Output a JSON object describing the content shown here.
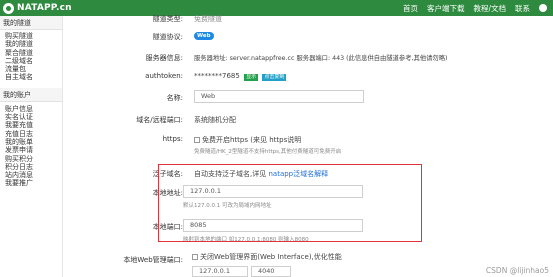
{
  "topbar": {
    "logo_text": "NATAPP.cn",
    "nav": [
      "首页",
      "客户端下载",
      "教程/文档",
      "联系"
    ]
  },
  "sidebar": {
    "tunnel_header": "我的隧道",
    "tunnel_items": [
      "购买隧道",
      "我的隧道",
      "聚合隧道",
      "二级域名",
      "流量包",
      "自主域名"
    ],
    "account_header": "我的账户",
    "account_items": [
      "账户信息",
      "实名认证",
      "我要充值",
      "充值日志",
      "我的账单",
      "发票申请",
      "购买积分",
      "积分日志",
      "站内消息",
      "我要推广"
    ]
  },
  "form": {
    "tunnel_type_label": "隧道类型:",
    "tunnel_type_value": "免费隧道",
    "protocol_label": "隧道协议:",
    "protocol_value": "Web",
    "server_label": "服务器信息:",
    "server_value": "服务器地址: server.natappfree.cc 服务器端口: 443 (此信息供自由隧道参考,其他请勿略)",
    "authtoken_label": "authtoken:",
    "authtoken_value": "********7685",
    "show_button": "显示",
    "copy_button": "点击复制",
    "name_label": "名称:",
    "name_value": "Web",
    "domain_label": "域名/远程端口:",
    "domain_value": "系统随机分配",
    "https_label": "https:",
    "https_checkbox": "免费开启https (来见 https说明",
    "https_link": "https说明",
    "https_hint": "免费隧道/HK_2型隧道不支持https,其他付费隧道可免费开启",
    "pan_label": "泛子域名:",
    "pan_value": "自动支持泛子域名,详见",
    "pan_link": "natapp泛域名解释",
    "local_addr_label": "本地地址:",
    "local_addr_value": "127.0.0.1",
    "local_addr_hint": "默认127.0.0.1 可改为局域内网地址",
    "local_port_label": "本地端口:",
    "local_port_value": "8085",
    "local_port_hint": "映射到本地的端口 如127.0.0.1:8080 则输入8080",
    "web_manage_label": "本地Web管理端口:",
    "web_manage_checkbox": "关闭Web管理界面(Web Interface),优化性能",
    "web_manage_ip": "127.0.0.1",
    "web_manage_port": "4040"
  },
  "watermark": "CSDN @lijinhao5",
  "colors": {
    "topbar": "#2d8a3e",
    "highlight_border": "#e0343a",
    "link": "#1e6fd9",
    "badge": "#1e88e5"
  }
}
